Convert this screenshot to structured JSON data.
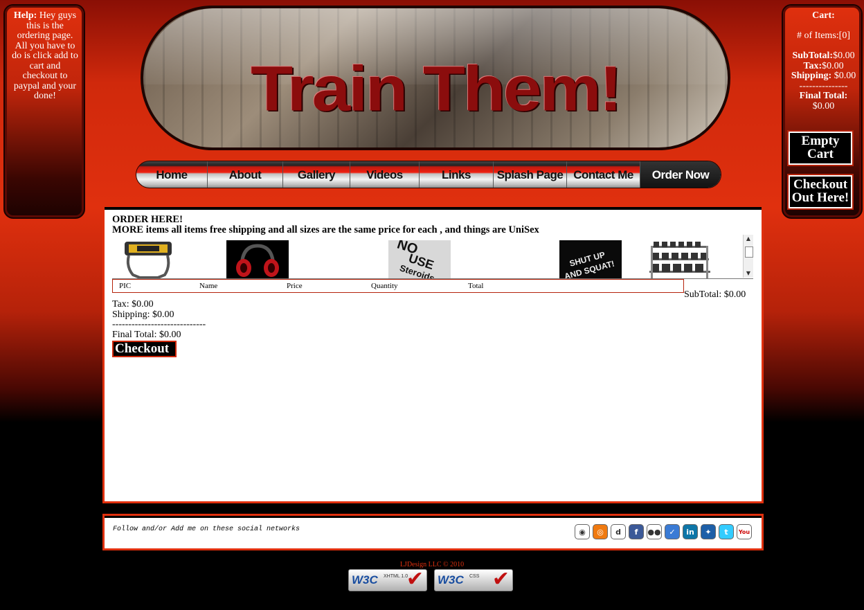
{
  "help": {
    "label": "Help:",
    "text": "Hey guys this is the ordering page. All you have to do is click add to cart and checkout to paypal and your done!"
  },
  "banner": {
    "title": "Train Them!"
  },
  "nav": {
    "items": [
      "Home",
      "About",
      "Gallery",
      "Videos",
      "Links",
      "Splash Page",
      "Contact Me",
      "Order Now"
    ]
  },
  "cart": {
    "title": "Cart:",
    "items_label": "# of Items:",
    "items_value": "[0]",
    "subtotal_label": "SubTotal:",
    "subtotal_value": "$0.00",
    "tax_label": "Tax:",
    "tax_value": "$0.00",
    "shipping_label": "Shipping:",
    "shipping_value": "$0.00",
    "divider": "---------------",
    "final_label": "Final Total:",
    "final_value": "$0.00",
    "empty_button": "Empty Cart",
    "checkout_button": "Checkout Out Here!"
  },
  "order": {
    "heading1": "ORDER HERE!",
    "heading2": "MORE items all items free shipping and all sizes are the same price for each , and things are UniSex",
    "products": [
      {
        "name": "stopwatch"
      },
      {
        "name": "headphones"
      },
      {
        "name": "no steroids shirt",
        "text": "NO USE Steroids"
      },
      {
        "name": "shut up and squat shirt",
        "text": "SHUT UP AND SQUAT!"
      },
      {
        "name": "dumbbell rack"
      }
    ],
    "columns": [
      "PIC",
      "Name",
      "Price",
      "Quantity",
      "Total"
    ],
    "subtotal": "SubTotal: $0.00",
    "tax": "Tax: $0.00",
    "shipping": "Shipping: $0.00",
    "divider": "-----------------------------",
    "final_total": "Final Total: $0.00",
    "checkout_button": "Checkout"
  },
  "social": {
    "text": "Follow and/or Add me on these social networks",
    "icons": [
      {
        "name": "stumbleupon-icon",
        "glyph": "◉",
        "color": "#ffffff"
      },
      {
        "name": "lastfm-icon",
        "glyph": "◎",
        "color": "#f07a10"
      },
      {
        "name": "delicious-icon",
        "glyph": "d",
        "color": "#ffffff"
      },
      {
        "name": "facebook-icon",
        "glyph": "f",
        "color": "#3b5998"
      },
      {
        "name": "flickr-icon",
        "glyph": "●●",
        "color": "#ffffff"
      },
      {
        "name": "friendfeed-icon",
        "glyph": "✓",
        "color": "#3a7bd5"
      },
      {
        "name": "linkedin-icon",
        "glyph": "in",
        "color": "#0e76a8"
      },
      {
        "name": "myspace-icon",
        "glyph": "✦",
        "color": "#1d5fa8"
      },
      {
        "name": "twitter-icon",
        "glyph": "t",
        "color": "#33ccff"
      },
      {
        "name": "youtube-icon",
        "glyph": "You",
        "color": "#ffffff"
      }
    ]
  },
  "footer": {
    "copyright": "LJDesign LLC © 2010",
    "badge_xhtml": {
      "w3": "W3C",
      "sub": "XHTML 1.0"
    },
    "badge_css": {
      "w3": "W3C",
      "sub": "CSS"
    }
  }
}
